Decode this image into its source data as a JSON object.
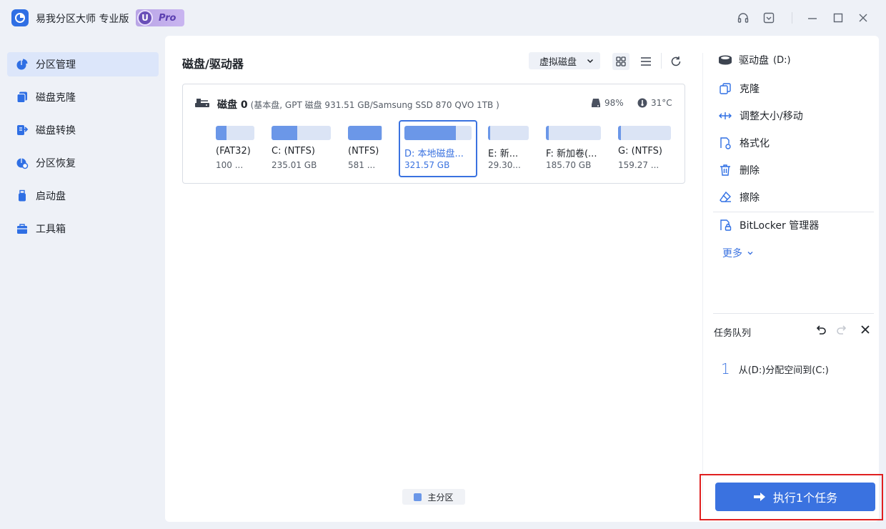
{
  "app": {
    "title": "易我分区大师 专业版",
    "badge_letter": "U",
    "badge_text": "Pro"
  },
  "titlebar_icons": [
    "headset-icon",
    "dropdown-icon",
    "minimize-icon",
    "maximize-icon",
    "close-icon"
  ],
  "sidebar": {
    "items": [
      {
        "label": "分区管理",
        "icon": "partition-pie-icon",
        "active": true
      },
      {
        "label": "磁盘克隆",
        "icon": "clone-icon",
        "active": false
      },
      {
        "label": "磁盘转换",
        "icon": "convert-icon",
        "active": false
      },
      {
        "label": "分区恢复",
        "icon": "recovery-icon",
        "active": false
      },
      {
        "label": "启动盘",
        "icon": "usb-icon",
        "active": false
      },
      {
        "label": "工具箱",
        "icon": "toolbox-icon",
        "active": false
      }
    ]
  },
  "main": {
    "title": "磁盘/驱动器",
    "virtual_disk_label": "虚拟磁盘",
    "disk": {
      "name": "磁盘 0",
      "meta": "(基本盘, GPT 磁盘 931.51 GB/Samsung SSD 870 QVO 1TB )",
      "health": "98%",
      "temperature": "31°C",
      "partitions": [
        {
          "name": "(FAT32)",
          "size": "100 ...",
          "used": 0.28,
          "selected": false
        },
        {
          "name": "C: (NTFS)",
          "size": "235.01 GB",
          "used": 0.43,
          "selected": false
        },
        {
          "name": "(NTFS)",
          "size": "581 ...",
          "used": 0.98,
          "selected": false
        },
        {
          "name": "D: 本地磁盘...",
          "size": "321.57 GB",
          "used": 0.77,
          "selected": true
        },
        {
          "name": "E: 新...",
          "size": "29.30...",
          "used": 0.05,
          "selected": false
        },
        {
          "name": "F: 新加卷(...",
          "size": "185.70 GB",
          "used": 0.05,
          "selected": false
        },
        {
          "name": "G: (NTFS)",
          "size": "159.27 ...",
          "used": 0.05,
          "selected": false
        }
      ]
    },
    "legend_label": "主分区"
  },
  "right_panel": {
    "drive_title": "驱动盘",
    "drive_letter": "(D:)",
    "actions": [
      {
        "label": "克隆",
        "icon": "clone-icon"
      },
      {
        "label": "调整大小/移动",
        "icon": "resize-icon"
      },
      {
        "label": "格式化",
        "icon": "format-icon"
      },
      {
        "label": "删除",
        "icon": "delete-icon"
      },
      {
        "label": "擦除",
        "icon": "eraser-icon"
      },
      {
        "label": "BitLocker 管理器",
        "icon": "bitlocker-icon"
      }
    ],
    "more_label": "更多",
    "queue_title": "任务队列",
    "queue_items": [
      {
        "num": "1",
        "text": "从(D:)分配空间到(C:)"
      }
    ],
    "execute_label": "执行1个任务"
  },
  "colors": {
    "accent": "#3a72e0",
    "bar_fill": "#6b97e8",
    "bar_bg": "#dbe4f5",
    "highlight": "#e02020"
  }
}
